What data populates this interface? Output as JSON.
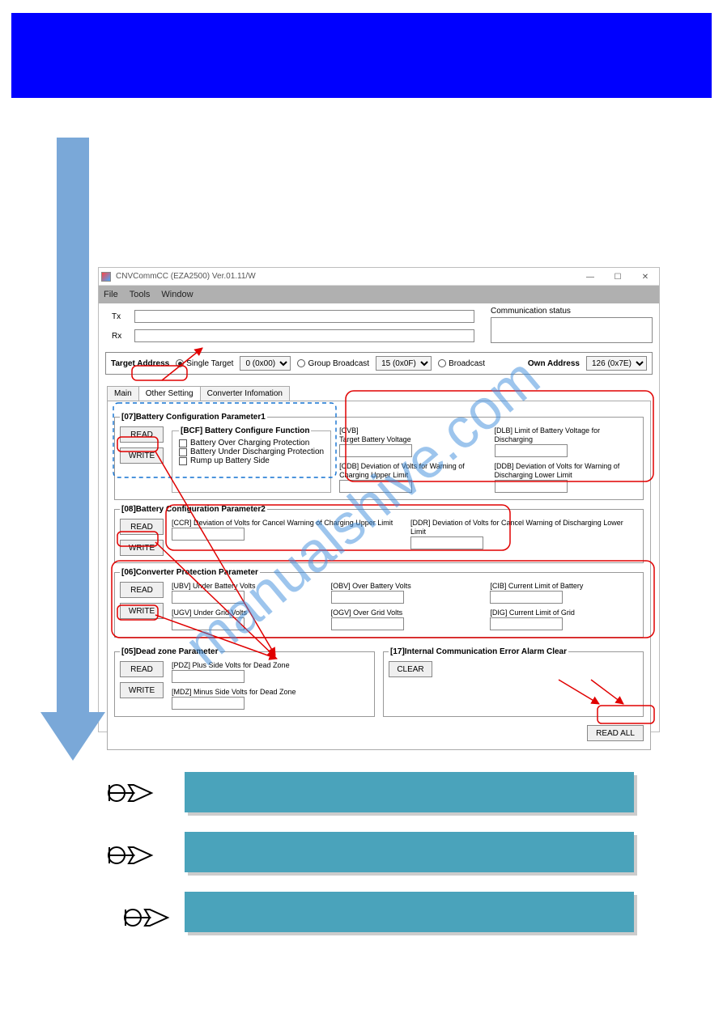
{
  "window": {
    "title": "CNVCommCC (EZA2500) Ver.01.11/W",
    "menu": {
      "file": "File",
      "tools": "Tools",
      "window": "Window"
    },
    "ctrl": {
      "min": "—",
      "max": "☐",
      "close": "✕"
    }
  },
  "io": {
    "tx": "Tx",
    "rx": "Rx",
    "comm": "Communication status"
  },
  "addr": {
    "label": "Target Address",
    "single": "Single Target",
    "single_val": "0 (0x00)",
    "group": "Group Broadcast",
    "group_val": "15 (0x0F)",
    "broadcast": "Broadcast",
    "own": "Own Address",
    "own_val": "126 (0x7E)"
  },
  "tabs": {
    "main": "Main",
    "other": "Other Setting",
    "conv": "Converter Infomation"
  },
  "btn": {
    "read": "READ",
    "write": "WRITE",
    "clear": "CLEAR",
    "readall": "READ ALL"
  },
  "g07": {
    "legend": "[07]Battery Configuration Parameter1",
    "bcf": "[BCF] Battery Configure Function",
    "c1": "Battery Over Charging Protection",
    "c2": "Battery Under Discharging Protection",
    "c3": "Rump up Battery Side",
    "cvb": "[CVB]\nTarget Battery Voltage",
    "dlb": "[DLB] Limit of Battery Voltage for Discharging",
    "cdb": "[CDB] Deviation of Volts for Warning of Charging Upper Limit",
    "ddb": "[DDB] Deviation of Volts for Warning of Discharging Lower Limit"
  },
  "g08": {
    "legend": "[08]Battery Configuration Parameter2",
    "ccr": "[CCR] Deviation of Volts for Cancel Warning of Charging Upper Limit",
    "ddr": "[DDR] Deviation of Volts for Cancel Warning of Discharging Lower Limit"
  },
  "g06": {
    "legend": "[06]Converter Protection Parameter",
    "ubv": "[UBV] Under Battery Volts",
    "obv": "[OBV] Over Battery Volts",
    "cib": "[CIB] Current Limit of Battery",
    "ugv": "[UGV] Under Grid Volts",
    "ogv": "[OGV] Over Grid Volts",
    "dig": "[DIG] Current Limit of Grid"
  },
  "g05": {
    "legend": "[05]Dead zone Parameter",
    "pdz": "[PDZ] Plus Side Volts for Dead Zone",
    "mdz": "[MDZ] Minus Side Volts for Dead Zone"
  },
  "g17": {
    "legend": "[17]Internal Communication Error Alarm Clear"
  },
  "watermark": "manualshive.com"
}
